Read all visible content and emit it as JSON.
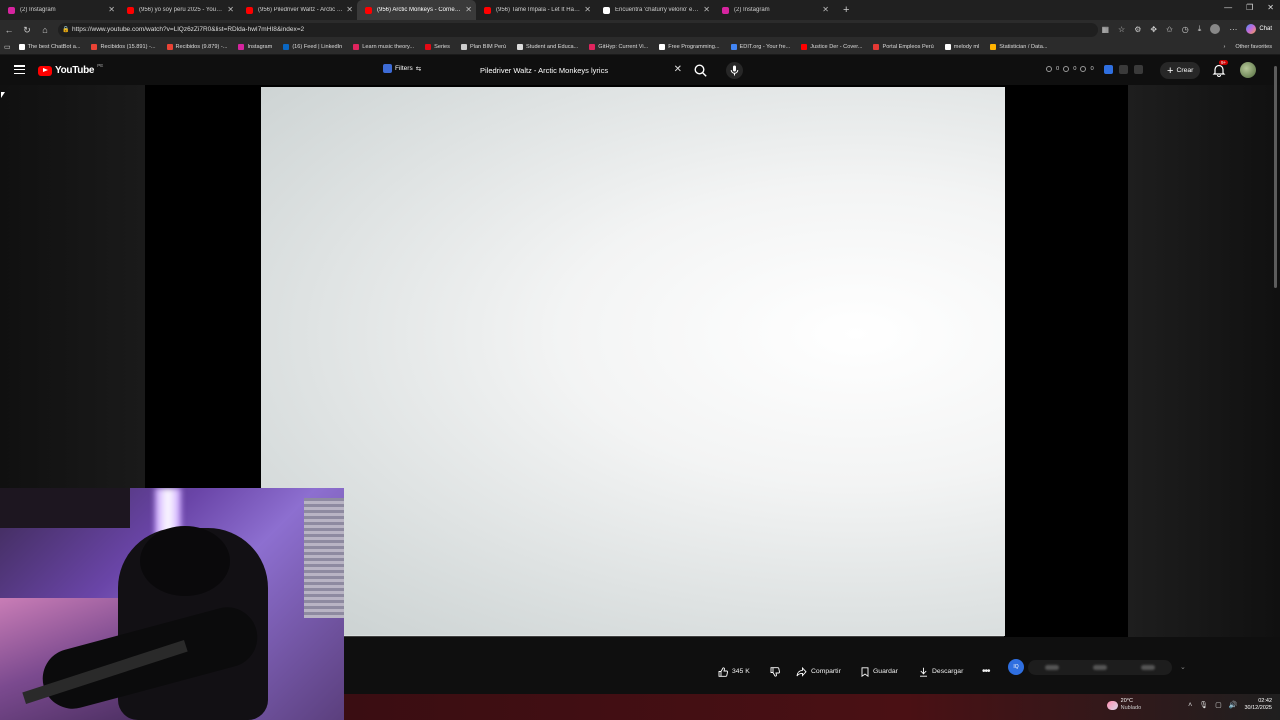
{
  "browser": {
    "tabs": [
      {
        "title": "(2) Instagram",
        "favicon_color": "#d6249f",
        "active": false
      },
      {
        "title": "(956) yo soy peru 2025 - YouTube",
        "favicon_color": "#ff0000",
        "active": false
      },
      {
        "title": "(956) Piledriver Waltz - Arctic Mon",
        "favicon_color": "#ff0000",
        "active": false
      },
      {
        "title": "(956) Arctic Monkeys - Cornersto",
        "favicon_color": "#ff0000",
        "active": true
      },
      {
        "title": "(956) Tame Impala - Let It Happen",
        "favicon_color": "#ff0000",
        "active": false
      },
      {
        "title": "Encuentra 'chaturry velorio' en Tik",
        "favicon_color": "#ffffff",
        "active": false
      },
      {
        "title": "(2) Instagram",
        "favicon_color": "#d6249f",
        "active": false
      }
    ],
    "url": "https://www.youtube.com/watch?v=LlQz6zZi7R0&list=RDlda-hwI7mHI8&index=2",
    "chat_label": "Chat",
    "bookmarks": [
      {
        "label": "The best ChatBot a...",
        "color": "#ffffff"
      },
      {
        "label": "Recibidos (15.891) -...",
        "color": "#ea4335"
      },
      {
        "label": "Recibidos (9.879) -...",
        "color": "#ea4335"
      },
      {
        "label": "Instagram",
        "color": "#d6249f"
      },
      {
        "label": "(16) Feed | LinkedIn",
        "color": "#0a66c2"
      },
      {
        "label": "Learn music theory...",
        "color": "#e0245e"
      },
      {
        "label": "Series",
        "color": "#e50914"
      },
      {
        "label": "Plan BIM Perú",
        "color": "#cccccc"
      },
      {
        "label": "Student and Educa...",
        "color": "#dddddd"
      },
      {
        "label": "GitHyp: Current Vi...",
        "color": "#e0245e"
      },
      {
        "label": "Free Programming...",
        "color": "#ffffff"
      },
      {
        "label": "EDIT.org - Your fre...",
        "color": "#4285f4"
      },
      {
        "label": "Justice Der - Cover...",
        "color": "#ff0000"
      },
      {
        "label": "Portal Empleos Perú",
        "color": "#e53935"
      },
      {
        "label": "melody ml",
        "color": "#ffffff"
      },
      {
        "label": "Statistician / Data...",
        "color": "#ffb300"
      }
    ],
    "other_favorites": "Other favorites"
  },
  "youtube": {
    "logo_text": "YouTube",
    "country_code": "PE",
    "filters_label": "Filters",
    "search_value": "Piledriver Waltz - Arctic Monkeys lyrics",
    "ext_counts": [
      "0",
      "0",
      "0"
    ],
    "create_label": "Crear",
    "notification_badge": "9+"
  },
  "actions": {
    "likes": "345 K",
    "share_label": "Compartir",
    "save_label": "Guardar",
    "download_label": "Descargar",
    "ext_label": "IQ"
  },
  "taskbar": {
    "temperature": "20°C",
    "weather_desc": "Nublado",
    "time": "02:42",
    "date": "30/12/2025"
  },
  "colors": {
    "yt_red": "#ff0000",
    "background": "#0f0f0f",
    "active_tab": "#3a3a3a"
  }
}
